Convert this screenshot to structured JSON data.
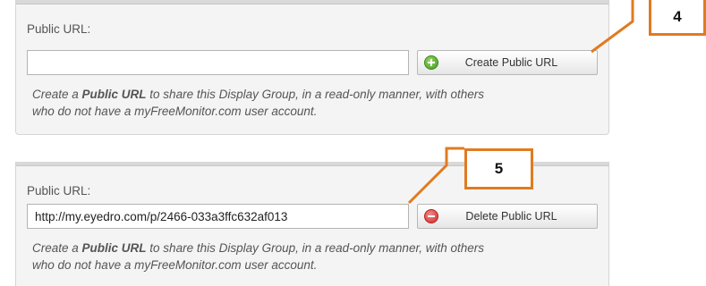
{
  "section1": {
    "label": "Public URL:",
    "input_value": "",
    "button_label": "Create Public URL",
    "button_icon": "plus-circle-icon",
    "desc_prefix": "Create a ",
    "desc_bold": "Public URL",
    "desc_line1_rest": " to share this Display Group, in a read-only manner, with others",
    "desc_line2": "who do not have a myFreeMonitor.com user account."
  },
  "section2": {
    "label": "Public URL:",
    "input_value": "http://my.eyedro.com/p/2466-033a3ffc632af013",
    "button_label": "Delete Public URL",
    "button_icon": "minus-circle-icon",
    "desc_prefix": "Create a ",
    "desc_bold": "Public URL",
    "desc_line1_rest": " to share this Display Group, in a read-only manner, with others",
    "desc_line2": "who do not have a myFreeMonitor.com user account."
  },
  "callouts": {
    "first": "4",
    "second": "5"
  },
  "colors": {
    "callout": "#e07b20",
    "create_icon": "#3f9a1e",
    "delete_icon": "#cc2a2a"
  }
}
